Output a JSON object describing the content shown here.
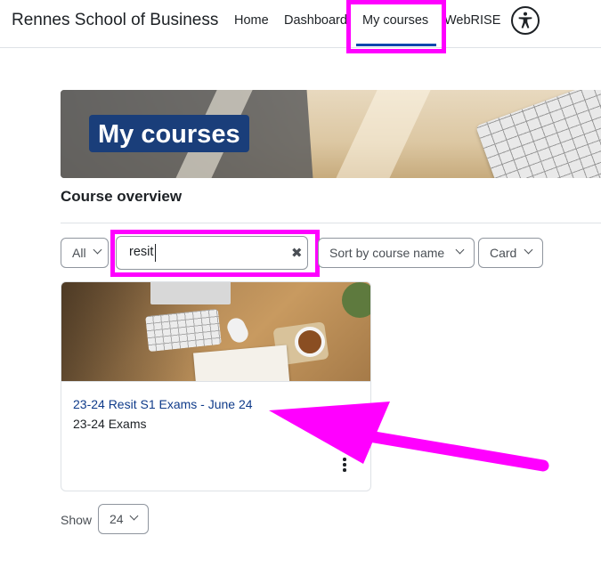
{
  "navbar": {
    "brand": "Rennes School of Business",
    "links": [
      "Home",
      "Dashboard",
      "My courses",
      "WebRISE"
    ],
    "active": "My courses",
    "accessibility_icon": "accessibility-icon"
  },
  "page": {
    "heading": "My courses",
    "section_title": "Course overview"
  },
  "filters": {
    "grouping": "All",
    "search_value": "resit",
    "sort": "Sort by course name",
    "view": "Card"
  },
  "course": {
    "name": "23-24 Resit S1 Exams - June 24",
    "category": "23-24 Exams",
    "menu_icon": "kebab-icon"
  },
  "pagination": {
    "label": "Show",
    "per_page": "24"
  },
  "colors": {
    "highlight": "#ff00ff",
    "accent": "#0f47ad",
    "heading_bg": "#1a3e7a"
  }
}
